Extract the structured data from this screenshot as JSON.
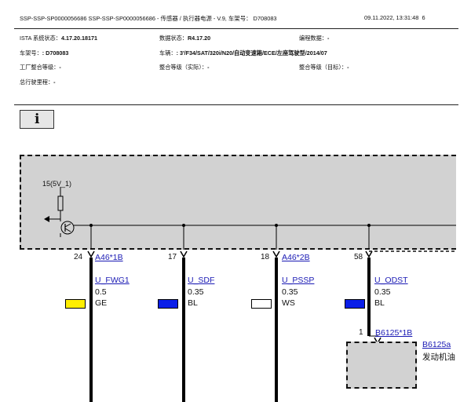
{
  "header": {
    "title": "SSP-SSP-SP0000056686 SSP-SSP-SP0000056686 - 传感器 / 执行器电源 - V.9, 车架号： D708083",
    "datetime": "09.11.2022, 13:31:48",
    "page": "6",
    "ista_label": "ISTA 系统状态：",
    "ista_value": "4.17.20.18171",
    "data_label": "数据状态：",
    "data_value": "R4.17.20",
    "programming_label": "编程数据：",
    "programming_value": "-",
    "vin_label": "车架号：",
    "vin_value": ": D708083",
    "vehicle_label": "车辆：",
    "vehicle_value": ": 3'/F34/SAT/320i/N20/自动变速箱/ECE/左座驾驶型/2014/07",
    "factory_level_label": "工厂整合等级：",
    "factory_level_value": "-",
    "actual_level_label": "整合等级（实际）：",
    "actual_level_value": "-",
    "target_level_label": "整合等级（目标）：",
    "target_level_value": "-",
    "mileage_label": "总行驶里程：",
    "mileage_value": "-"
  },
  "info_icon": "i",
  "ecu": {
    "supply_label": "15(5V_1)"
  },
  "wires": [
    {
      "pin": "24",
      "connector": "A46*1B",
      "signal": "U_FWG1",
      "size": "0.5",
      "color_code": "GE",
      "swatch": "#ffee00"
    },
    {
      "pin": "17",
      "connector": "",
      "signal": "U_SDF",
      "size": "0.35",
      "color_code": "BL",
      "swatch": "#0a1ee8"
    },
    {
      "pin": "18",
      "connector": "A46*2B",
      "signal": "U_PSSP",
      "size": "0.35",
      "color_code": "WS",
      "swatch": "#ffffff"
    },
    {
      "pin": "58",
      "connector": "",
      "signal": "U_ODST",
      "size": "0.35",
      "color_code": "BL",
      "swatch": "#0a1ee8"
    }
  ],
  "component": {
    "pin": "1",
    "connector": "B6125*1B",
    "name": "B6125a",
    "desc": "发动机油"
  }
}
